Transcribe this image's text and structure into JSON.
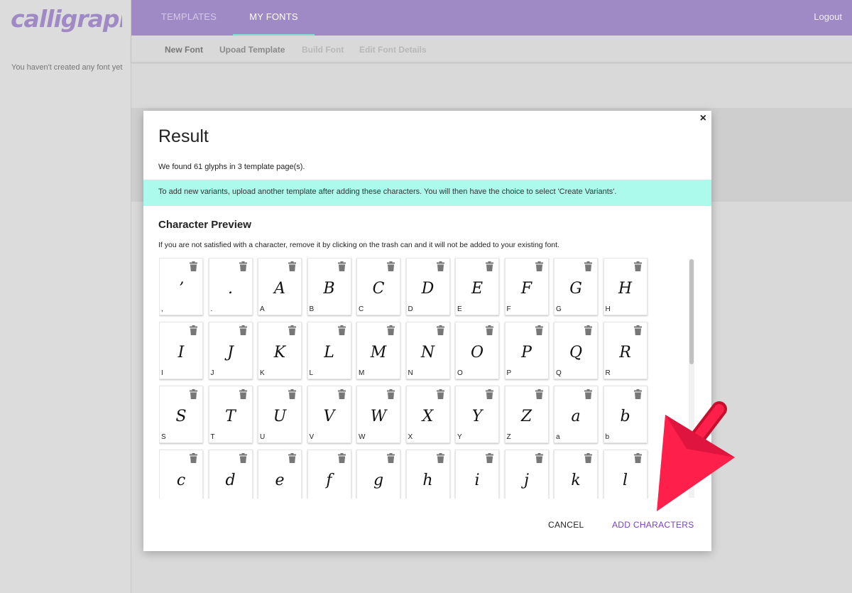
{
  "brand": {
    "logo_text": "calligraphr"
  },
  "sidebar": {
    "note": "You haven't created any font yet"
  },
  "topnav": {
    "tabs": [
      "TEMPLATES",
      "MY FONTS"
    ],
    "logout": "Logout"
  },
  "subnav": [
    "New Font",
    "Upoad Template",
    "Build Font",
    "Edit Font Details"
  ],
  "modal": {
    "close": "×",
    "title": "Result",
    "found_text": "We found 61 glyphs in 3 template page(s).",
    "info_banner": "To add new variants, upload another template after adding these characters. You will then have the choice to select 'Create Variants'.",
    "preview_title": "Character Preview",
    "preview_hint": "If you are not satisfied with a character, remove it by clicking on the trash can and it will not be added to your existing font.",
    "cancel": "CANCEL",
    "add": "ADD CHARACTERS"
  },
  "characters": [
    {
      "glyph": "ʼ",
      "label": ","
    },
    {
      "glyph": ".",
      "label": "."
    },
    {
      "glyph": "A",
      "label": "A"
    },
    {
      "glyph": "B",
      "label": "B"
    },
    {
      "glyph": "C",
      "label": "C"
    },
    {
      "glyph": "D",
      "label": "D"
    },
    {
      "glyph": "E",
      "label": "E"
    },
    {
      "glyph": "F",
      "label": "F"
    },
    {
      "glyph": "G",
      "label": "G"
    },
    {
      "glyph": "H",
      "label": "H"
    },
    {
      "glyph": "I",
      "label": "I"
    },
    {
      "glyph": "J",
      "label": "J"
    },
    {
      "glyph": "K",
      "label": "K"
    },
    {
      "glyph": "L",
      "label": "L"
    },
    {
      "glyph": "M",
      "label": "M"
    },
    {
      "glyph": "N",
      "label": "N"
    },
    {
      "glyph": "O",
      "label": "O"
    },
    {
      "glyph": "P",
      "label": "P"
    },
    {
      "glyph": "Q",
      "label": "Q"
    },
    {
      "glyph": "R",
      "label": "R"
    },
    {
      "glyph": "S",
      "label": "S"
    },
    {
      "glyph": "T",
      "label": "T"
    },
    {
      "glyph": "U",
      "label": "U"
    },
    {
      "glyph": "V",
      "label": "V"
    },
    {
      "glyph": "W",
      "label": "W"
    },
    {
      "glyph": "X",
      "label": "X"
    },
    {
      "glyph": "Y",
      "label": "Y"
    },
    {
      "glyph": "Z",
      "label": "Z"
    },
    {
      "glyph": "a",
      "label": "a"
    },
    {
      "glyph": "b",
      "label": "b"
    },
    {
      "glyph": "c",
      "label": ""
    },
    {
      "glyph": "d",
      "label": ""
    },
    {
      "glyph": "e",
      "label": ""
    },
    {
      "glyph": "f",
      "label": ""
    },
    {
      "glyph": "g",
      "label": ""
    },
    {
      "glyph": "h",
      "label": ""
    },
    {
      "glyph": "i",
      "label": ""
    },
    {
      "glyph": "j",
      "label": ""
    },
    {
      "glyph": "k",
      "label": ""
    },
    {
      "glyph": "l",
      "label": ""
    }
  ],
  "colors": {
    "topbar": "#a08ac5",
    "active_tab_underline": "#7fe0cf",
    "info_banner": "#abfaeb",
    "primary_action": "#7a3fbf",
    "annotation_arrow": "#ff1f4b"
  },
  "icons": {
    "trash": "trash-icon",
    "close": "close-icon",
    "annotation": "red-arrow"
  }
}
